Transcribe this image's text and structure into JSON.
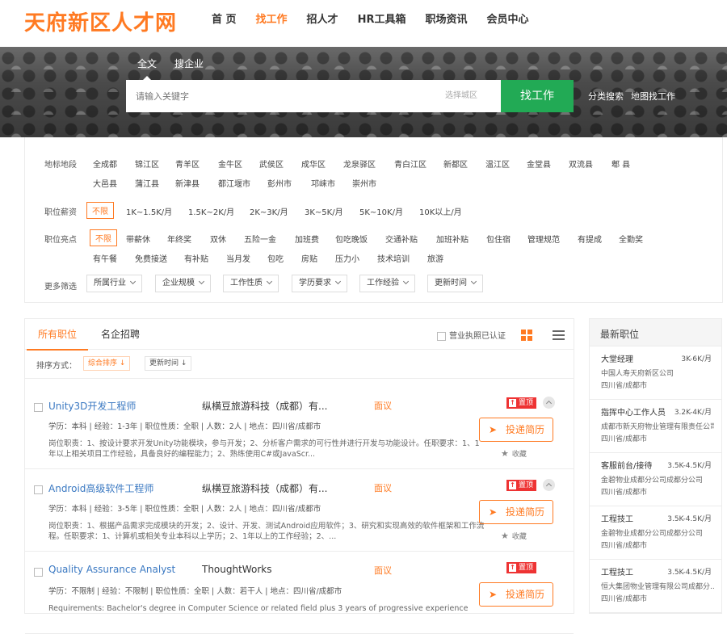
{
  "brand": {
    "name": "天府新区人才网",
    "accent": "#ff7a22",
    "green": "#22aa55"
  },
  "nav": [
    {
      "label": "首 页",
      "active": false
    },
    {
      "label": "找工作",
      "active": true
    },
    {
      "label": "招人才",
      "active": false
    },
    {
      "label": "HR工具箱",
      "active": false
    },
    {
      "label": "职场资讯",
      "active": false
    },
    {
      "label": "会员中心",
      "active": false
    }
  ],
  "search": {
    "tabs": [
      "全文",
      "搜企业"
    ],
    "placeholder": "请输入关键字",
    "city_placeholder": "选择城区",
    "button": "找工作",
    "links": [
      "分类搜索",
      "地图找工作"
    ]
  },
  "filters": {
    "region_label": "地标地段",
    "regions_row1": [
      "全成都",
      "锦江区",
      "青羊区",
      "金牛区",
      "武侯区",
      "成华区",
      "龙泉驿区",
      "青白江区",
      "新都区",
      "温江区",
      "金堂县",
      "双流县",
      "郫 县"
    ],
    "regions_row2": [
      "大邑县",
      "蒲江县",
      "新津县",
      "都江堰市",
      "彭州市",
      "邛崃市",
      "崇州市"
    ],
    "salary_label": "职位薪资",
    "salaries": [
      "不限",
      "1K~1.5K/月",
      "1.5K~2K/月",
      "2K~3K/月",
      "3K~5K/月",
      "5K~10K/月",
      "10K以上/月"
    ],
    "perk_label": "职位亮点",
    "perks_row1": [
      "不限",
      "带薪休",
      "年终奖",
      "双休",
      "五险一金",
      "加班费",
      "包吃晚饭",
      "交通补贴",
      "加班补贴",
      "包住宿",
      "管理规范",
      "有提成",
      "全勤奖"
    ],
    "perks_row2": [
      "有午餐",
      "免费接送",
      "有补贴",
      "当月发",
      "包吃",
      "房贴",
      "压力小",
      "技术培训",
      "旅游"
    ],
    "more_label": "更多筛选",
    "dropdowns": [
      "所属行业",
      "企业规模",
      "工作性质",
      "学历要求",
      "工作经验",
      "更新时间"
    ]
  },
  "list": {
    "tabs": [
      "所有职位",
      "名企招聘"
    ],
    "verify_label": "营业执照已认证",
    "sort_label": "排序方式：",
    "sort_options": [
      "综合排序",
      "更新时间"
    ],
    "top_label": "置顶",
    "apply_label": "投递简历",
    "fav_label": "收藏",
    "jobs": [
      {
        "title": "Unity3D开发工程师",
        "company": "纵横豆旅游科技（成都）有...",
        "salary": "面议",
        "meta": "学历：本科 | 经验：1-3年 | 职位性质：全职 | 人数：2人 | 地点：四川省/成都市",
        "desc": "岗位职责：1、按设计要求开发Unity功能模块，参与开发；2、分析客户需求的可行性并进行开发与功能设计。任职要求：1、1年以上相关项目工作经验，具备良好的编程能力；2、熟练使用C#或JavaScr..."
      },
      {
        "title": "Android高级软件工程师",
        "company": "纵横豆旅游科技（成都）有...",
        "salary": "面议",
        "meta": "学历：本科 | 经验：3-5年 | 职位性质：全职 | 人数：2人 | 地点：四川省/成都市",
        "desc": "岗位职责：1、根据产品需求完成模块的开发；2、设计、开发、测试Android应用软件；3、研究和实现高效的软件框架和工作流程。任职要求：1、计算机或相关专业本科以上学历；2、1年以上的工作经验；2、..."
      },
      {
        "title": "Quality Assurance Analyst",
        "company": "ThoughtWorks",
        "salary": "面议",
        "meta": "学历：不限制 | 经验：不限制 | 职位性质：全职 | 人数：若干人 | 地点：四川省/成都市",
        "desc": "Requirements: Bachelor's degree in Computer Science or related field plus 3 years of progressive experience"
      }
    ]
  },
  "sidebar": {
    "title": "最新职位",
    "jobs": [
      {
        "title": "大堂经理",
        "salary": "3K-6K/月",
        "company": "中国人寿天府新区公司",
        "location": "四川省/成都市"
      },
      {
        "title": "指挥中心工作人员",
        "salary": "3.2K-4K/月",
        "company": "成都市新天府物业管理有限责任公司",
        "location": "四川省/成都市"
      },
      {
        "title": "客服前台/接待",
        "salary": "3.5K-4.5K/月",
        "company": "金碧物业成都分公司成都分公司",
        "location": "四川省/成都市"
      },
      {
        "title": "工程技工",
        "salary": "3.5K-4.5K/月",
        "company": "金碧物业成都分公司成都分公司",
        "location": "四川省/成都市"
      },
      {
        "title": "工程技工",
        "salary": "3.5K-4.5K/月",
        "company": "恒大集团物业管理有限公司成都分...",
        "location": "四川省/成都市"
      }
    ]
  }
}
